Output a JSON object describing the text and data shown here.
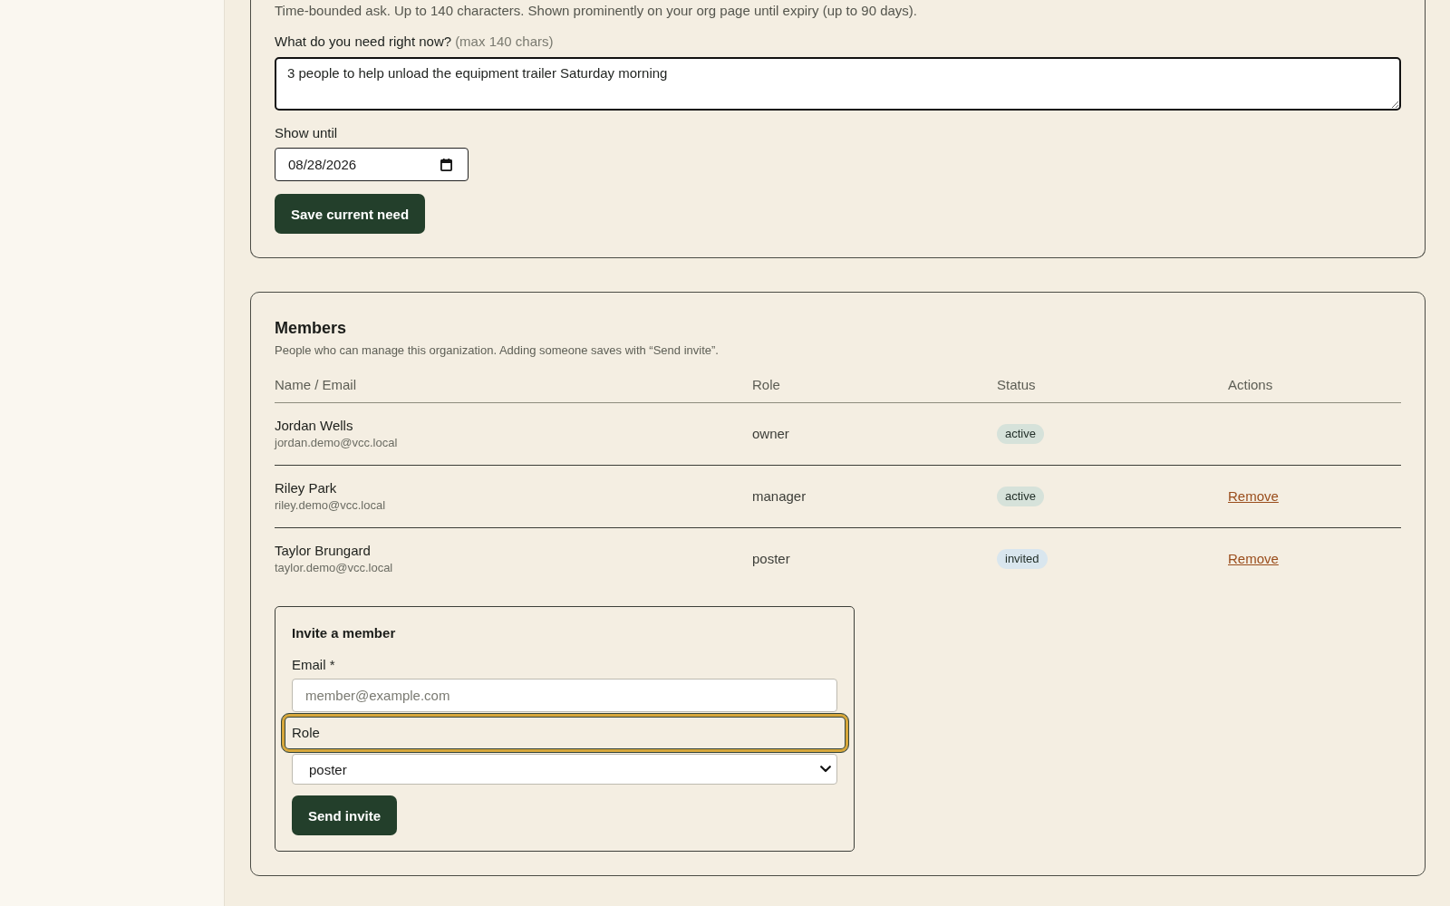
{
  "current_need": {
    "description": "Time-bounded ask. Up to 140 characters. Shown prominently on your org page until expiry (up to 90 days).",
    "need_field": {
      "label": "What do you need right now?",
      "hint": "(max 140 chars)",
      "value": "3 people to help unload the equipment trailer Saturday morning"
    },
    "show_until": {
      "label": "Show until",
      "value": "08/28/2026"
    },
    "save_button": "Save current need"
  },
  "members": {
    "title": "Members",
    "description": "People who can manage this organization. Adding someone saves with “Send invite”.",
    "table": {
      "columns": [
        "Name / Email",
        "Role",
        "Status",
        "Actions"
      ],
      "rows": [
        {
          "name": "Jordan Wells",
          "email": "jordan.demo@vcc.local",
          "role": "owner",
          "status": {
            "label": "active",
            "color": "#d6e2da"
          }
        },
        {
          "name": "Riley Park",
          "email": "riley.demo@vcc.local",
          "role": "manager",
          "status": {
            "label": "active",
            "color": "#d6e2da"
          },
          "action": "Remove"
        },
        {
          "name": "Taylor Brungard",
          "email": "taylor.demo@vcc.local",
          "role": "poster",
          "status": {
            "label": "invited",
            "color": "#d9e6ee"
          },
          "action": "Remove"
        }
      ]
    },
    "invite": {
      "title": "Invite a member",
      "email": {
        "label": "Email *",
        "placeholder": "member@example.com",
        "focused": false
      },
      "role": {
        "label": "Role",
        "value": "poster",
        "focused": true
      },
      "button": "Send invite"
    }
  }
}
